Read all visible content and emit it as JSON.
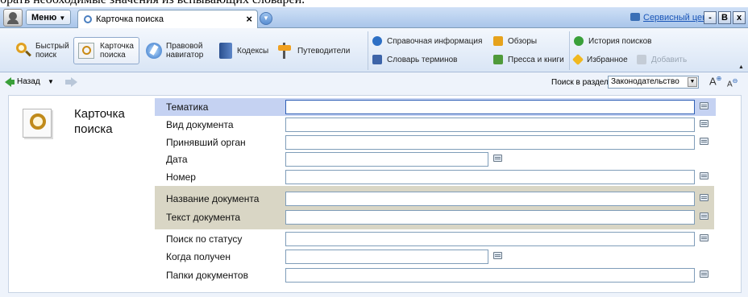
{
  "top_text": "брать необходимые значения из вспывающих словарей.",
  "titlebar": {
    "menu_label": "Меню",
    "tab_label": "Карточка поиска",
    "tab_close": "×",
    "service_link": "Сервисный центр",
    "win_minimize": "-",
    "win_restore": "B",
    "win_close": "x"
  },
  "toolbar": {
    "quick_search": "Быстрый поиск",
    "search_card": "Карточка поиска",
    "legal_navigator": "Правовой навигатор",
    "codes": "Кодексы",
    "guides": "Путеводители",
    "reference_info": "Справочная информация",
    "glossary": "Словарь терминов",
    "reviews": "Обзоры",
    "press_books": "Пресса и книги",
    "search_history": "История поисков",
    "favorites": "Избранное",
    "add": "Добавить"
  },
  "nav": {
    "back_label": "Назад",
    "search_in_section_label": "Поиск в разделе",
    "section_value": "Законодательство"
  },
  "card": {
    "title": "Карточка поиска",
    "fields": [
      {
        "label": "Тематика",
        "value": ""
      },
      {
        "label": "Вид документа",
        "value": ""
      },
      {
        "label": "Принявший орган",
        "value": ""
      },
      {
        "label": "Дата",
        "value": ""
      },
      {
        "label": "Номер",
        "value": ""
      },
      {
        "label": "Название документа",
        "value": ""
      },
      {
        "label": "Текст документа",
        "value": ""
      },
      {
        "label": "Поиск по статусу",
        "value": ""
      },
      {
        "label": "Когда получен",
        "value": ""
      },
      {
        "label": "Папки документов",
        "value": ""
      }
    ]
  },
  "colors": {
    "accent": "#2f5fb5",
    "highlight_row": "#c5d2f2",
    "text_group_bg": "#d9d6c5",
    "toolbar_bg": "#dbe6f5"
  }
}
